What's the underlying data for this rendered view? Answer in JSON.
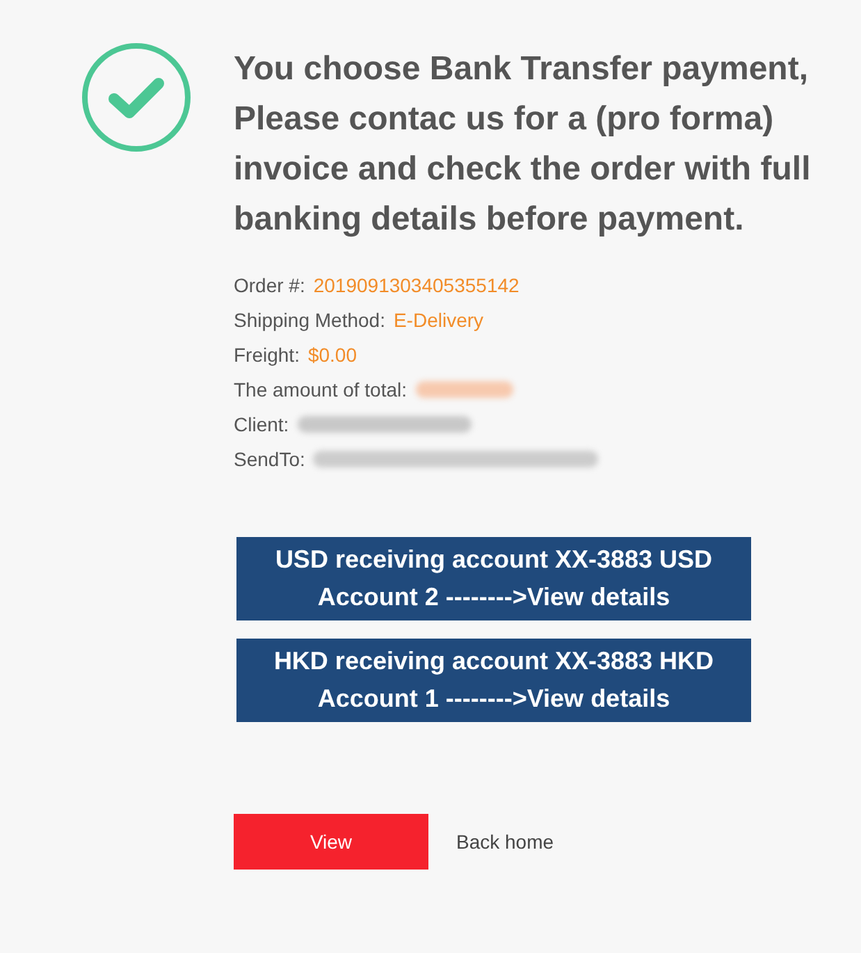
{
  "status": {
    "kind": "success"
  },
  "message": "You choose Bank Transfer payment, Please contac us for a (pro forma) invoice and check the order with full banking details before payment.",
  "details": [
    {
      "label": "Order #:",
      "kind": "value",
      "value": "2019091303405355142"
    },
    {
      "label": "Shipping Method:",
      "kind": "value",
      "value": "E-Delivery"
    },
    {
      "label": "Freight:",
      "kind": "value",
      "value": "$0.00"
    },
    {
      "label": "The amount of total:",
      "kind": "blurred",
      "color": "#f7c9ae"
    },
    {
      "label": "Client:",
      "kind": "blurred",
      "color": "#c8c8c8"
    },
    {
      "label": "SendTo:",
      "kind": "blurred",
      "color": "#cccccc"
    }
  ],
  "accounts": [
    {
      "line_1": "USD receiving account XX-3883 USD",
      "line_2": "Account 2 -------->View details"
    },
    {
      "line_1": "HKD receiving account XX-3883 HKD",
      "line_2": "Account 1 -------->View details"
    }
  ],
  "actions": {
    "primary": "View",
    "secondary": "Back home"
  }
}
